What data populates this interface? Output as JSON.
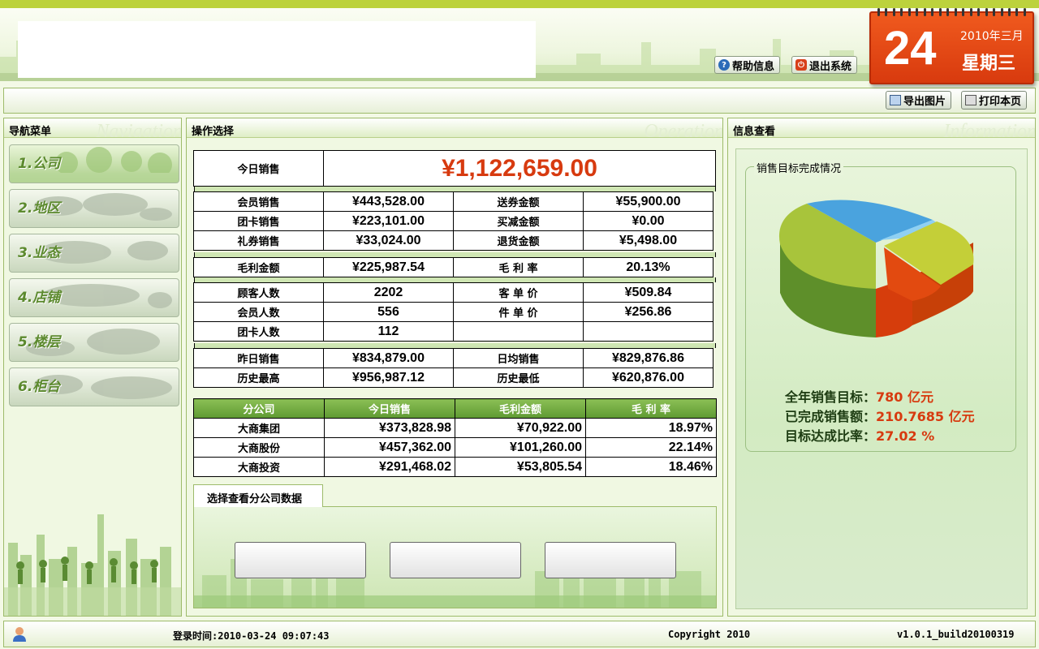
{
  "header": {
    "help_label": "帮助信息",
    "logout_label": "退出系统"
  },
  "calendar": {
    "day": "24",
    "year_month": "2010年三月",
    "weekday": "星期三"
  },
  "toolbar": {
    "export_label": "导出图片",
    "print_label": "打印本页"
  },
  "nav": {
    "title": "导航菜单",
    "watermark": "Navigation",
    "items": [
      {
        "label": "1.公司"
      },
      {
        "label": "2.地区"
      },
      {
        "label": "3.业态"
      },
      {
        "label": "4.店铺"
      },
      {
        "label": "5.楼层"
      },
      {
        "label": "6.柜台"
      }
    ]
  },
  "operation": {
    "title": "操作选择",
    "watermark": "Operation",
    "today_sales_label": "今日销售",
    "today_sales_value": "¥1,122,659.00",
    "rows_a": [
      [
        "会员销售",
        "¥443,528.00",
        "送券金额",
        "¥55,900.00"
      ],
      [
        "团卡销售",
        "¥223,101.00",
        "买减金额",
        "¥0.00"
      ],
      [
        "礼券销售",
        "¥33,024.00",
        "退货金额",
        "¥5,498.00"
      ]
    ],
    "rows_b": [
      [
        "毛利金额",
        "¥225,987.54",
        "毛 利 率",
        "20.13%"
      ]
    ],
    "rows_c": [
      [
        "顾客人数",
        "2202",
        "客 单 价",
        "¥509.84"
      ],
      [
        "会员人数",
        "556",
        "件 单 价",
        "¥256.86"
      ],
      [
        "团卡人数",
        "112",
        "",
        ""
      ]
    ],
    "rows_d": [
      [
        "昨日销售",
        "¥834,879.00",
        "日均销售",
        "¥829,876.86"
      ],
      [
        "历史最高",
        "¥956,987.12",
        "历史最低",
        "¥620,876.00"
      ]
    ],
    "branch_headers": [
      "分公司",
      "今日销售",
      "毛利金额",
      "毛 利 率"
    ],
    "branch_rows": [
      [
        "大商集团",
        "¥373,828.98",
        "¥70,922.00",
        "18.97%"
      ],
      [
        "大商股份",
        "¥457,362.00",
        "¥101,260.00",
        "22.14%"
      ],
      [
        "大商投资",
        "¥291,468.02",
        "¥53,805.54",
        "18.46%"
      ]
    ],
    "subsidiary_tab": "选择查看分公司数据"
  },
  "info": {
    "title": "信息查看",
    "watermark": "Information",
    "chart_caption": "销售目标完成情况",
    "annual_target_label": "全年销售目标：",
    "annual_target_value": "780 亿元",
    "completed_label": "已完成销售额：",
    "completed_value": "210.7685 亿元",
    "ratio_label": "目标达成比率：",
    "ratio_value": "27.02 %"
  },
  "colors": {
    "accent_orange": "#d73a0f",
    "header_green": "#bcd23c",
    "pie_green": "#a7c43a",
    "pie_blue": "#4aa3de",
    "pie_orange": "#e24a10"
  },
  "footer": {
    "login_time": "登录时间:2010-03-24 09:07:43",
    "copyright": "Copyright 2010",
    "version": "v1.0.1_build20100319"
  }
}
